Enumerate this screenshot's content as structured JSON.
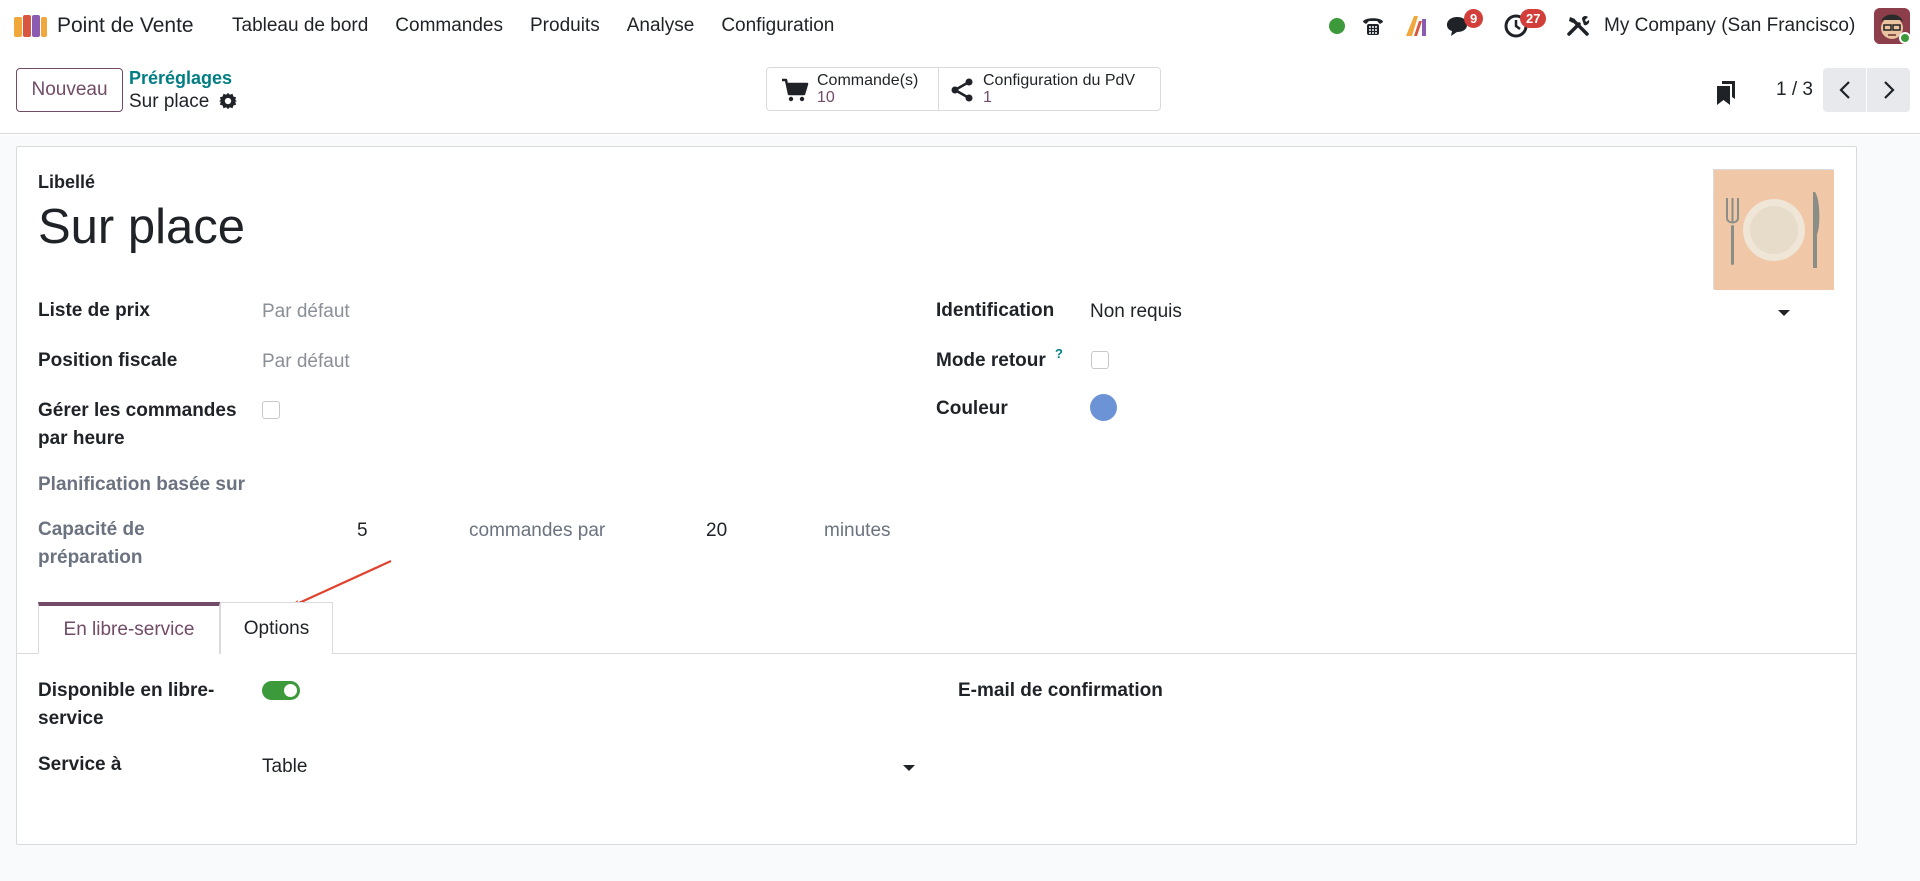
{
  "navbar": {
    "app_name": "Point de Vente",
    "menu": [
      "Tableau de bord",
      "Commandes",
      "Produits",
      "Analyse",
      "Configuration"
    ],
    "badges": {
      "messages": "9",
      "activities": "27"
    },
    "company": "My Company (San Francisco)",
    "icons": [
      "pos-logo-icon",
      "online-status-icon",
      "phone-icon",
      "ai-icon",
      "chat-icon",
      "clock-icon",
      "tools-icon",
      "user-avatar"
    ]
  },
  "control_panel": {
    "new_button": "Nouveau",
    "breadcrumb_parent": "Préréglages",
    "breadcrumb_current": "Sur place",
    "smart_buttons": [
      {
        "title": "Commande(s)",
        "value": "10"
      },
      {
        "title": "Configuration du PdV",
        "value": "1"
      }
    ],
    "pager": "1 / 3"
  },
  "form": {
    "label_caption": "Libellé",
    "title": "Sur place",
    "left_fields": {
      "pricelist_label": "Liste de prix",
      "pricelist_value": "Par défaut",
      "fiscal_label": "Position fiscale",
      "fiscal_value": "Par défaut",
      "hourly_label_1": "Gérer les commandes",
      "hourly_label_2": "par heure",
      "hourly_checked": false,
      "planning_label": "Planification basée sur",
      "capacity_label_1": "Capacité de",
      "capacity_label_2": "préparation",
      "capacity_orders": "5",
      "capacity_text": "commandes par",
      "capacity_minutes": "20",
      "minutes_text": "minutes"
    },
    "right_fields": {
      "identification_label": "Identification",
      "identification_value": "Non requis",
      "return_label": "Mode retour",
      "return_help": "?",
      "return_checked": false,
      "color_label": "Couleur",
      "color_value": "#6b93d6"
    }
  },
  "tabs": {
    "active": "En libre-service",
    "other": "Options"
  },
  "tab_content": {
    "self_service_label_1": "Disponible en libre-",
    "self_service_label_2": "service",
    "self_service_enabled": true,
    "service_label": "Service à",
    "service_value": "Table",
    "email_label": "E-mail de confirmation"
  },
  "colors": {
    "primary": "#714b67",
    "link": "#017e84",
    "success": "#3c9a3a",
    "badge": "#d23f3a",
    "annotation": "#e0442f"
  }
}
